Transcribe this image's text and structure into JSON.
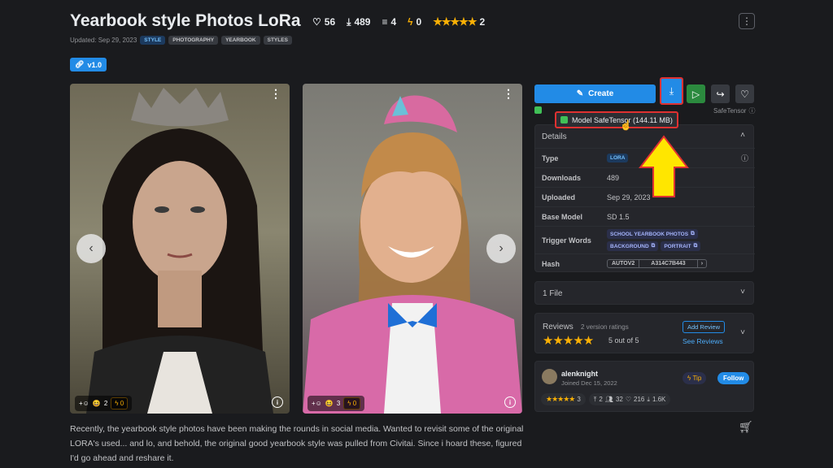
{
  "model": {
    "title": "Yearbook style Photos LoRa",
    "stats": {
      "likes": "56",
      "downloads": "489",
      "comments": "4",
      "buzz": "0",
      "rating_count": "2"
    },
    "updated": "Updated: Sep 29, 2023",
    "tags": [
      "STYLE",
      "PHOTOGRAPHY",
      "YEARBOOK",
      "STYLES"
    ],
    "version": "v1.0"
  },
  "gallery": [
    {
      "reaction_count": "2",
      "buzz": "0"
    },
    {
      "reaction_count": "3",
      "buzz": "0"
    }
  ],
  "description": "Recently, the yearbook style photos have been making the rounds in social media. Wanted to revisit some of the original LORA's used... and lo, and behold, the original good yearbook style was pulled from Civitai. Since i hoard these, figured I'd go ahead and reshare it.",
  "actions": {
    "create_label": "Create",
    "safetensor_label": "SafeTensor",
    "download_tooltip": "Model SafeTensor (144.11 MB)"
  },
  "details": {
    "header": "Details",
    "rows": {
      "type_label": "Type",
      "type_value": "LORA",
      "downloads_label": "Downloads",
      "downloads_value": "489",
      "uploaded_label": "Uploaded",
      "uploaded_value": "Sep 29, 2023",
      "base_label": "Base Model",
      "base_value": "SD 1.5",
      "trigger_label": "Trigger Words",
      "triggers": [
        "SCHOOL YEARBOOK PHOTOS",
        "BACKGROUND",
        "PORTRAIT"
      ],
      "hash_label": "Hash",
      "hash_type": "AUTOV2",
      "hash_value": "A314C7B443"
    }
  },
  "files": {
    "label": "1 File"
  },
  "reviews": {
    "label": "Reviews",
    "ratings": "2 version ratings",
    "score": "5 out of 5",
    "add_label": "Add Review",
    "see_label": "See Reviews"
  },
  "creator": {
    "name": "alenknight",
    "joined": "Joined Dec 15, 2022",
    "tip_label": "Tip",
    "follow_label": "Follow",
    "stats": {
      "rating": "3",
      "uploads": "2",
      "followers": "32",
      "favorites": "216",
      "downloads": "1.6K"
    }
  },
  "colors": {
    "accent": "#228be6",
    "highlight": "#e03131",
    "arrow": "#ffe600",
    "star": "#fab005"
  }
}
